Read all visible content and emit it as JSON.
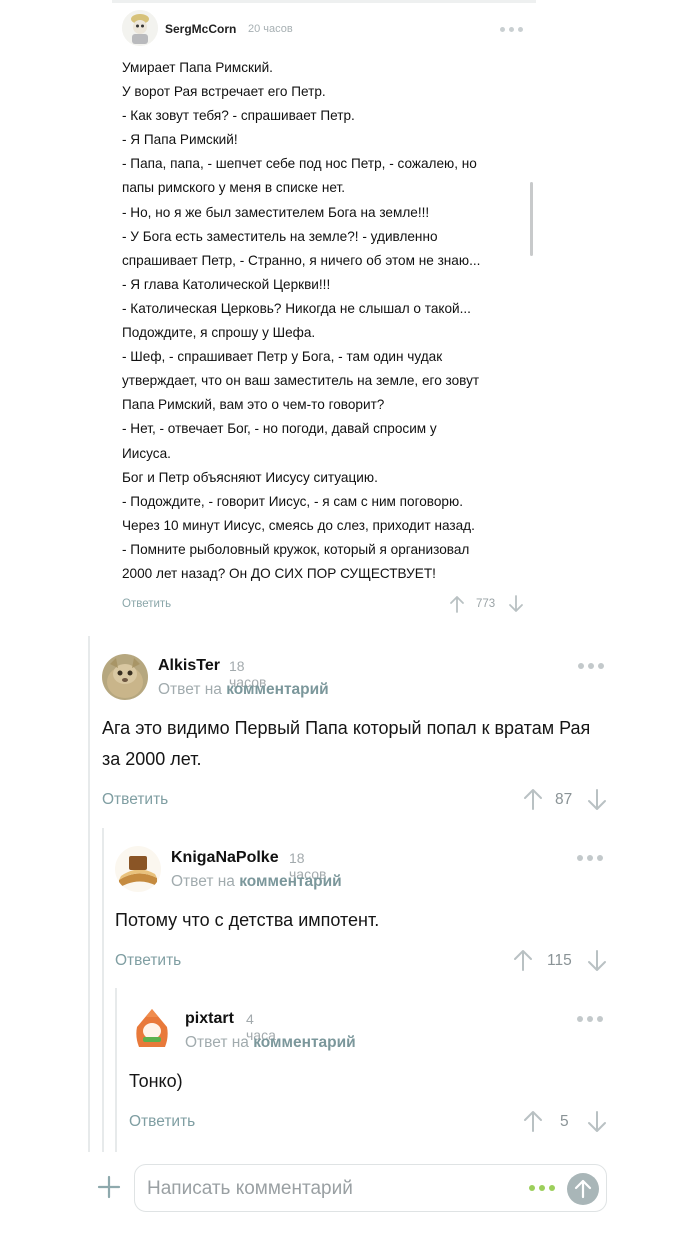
{
  "quoted": {
    "author": "SergMcCorn",
    "time": "20 часов",
    "text": "Умирает Папа Римский.\nУ ворот Рая встречает его Петр.\n- Как зовут тебя? - спрашивает Петр.\n- Я Папа Римский!\n- Папа, папа, - шепчет себе под нос Петр, - сожалею, но\nпапы римского у меня в списке нет.\n- Но, но я же был заместителем Бога на земле!!!\n- У Бога есть заместитель на земле?! - удивленно\nспрашивает Петр, - Странно, я ничего об этом не знаю...\n- Я глава Католической Церкви!!!\n- Католическая Церковь? Никогда не слышал о такой...\nПодождите, я спрошу у Шефа.\n- Шеф, - спрашивает Петр у Бога, - там один чудак\nутверждает, что он ваш заместитель на земле, его зовут\nПапа Римский, вам это о чем-то говорит?\n- Нет, - отвечает Бог, - но погоди, давай спросим у\nИисуса.\nБог и Петр объясняют Иисусу ситуацию.\n- Подождите, - говорит Иисус, - я сам с ним поговорю.\nЧерез 10 минут Иисус, смеясь до слез, приходит назад.\n- Помните рыболовный кружок, который я организовал\n2000 лет назад? Он ДО СИХ ПОР СУЩЕСТВУЕТ!",
    "reply_label": "Ответить",
    "score": "773"
  },
  "comments": [
    {
      "author": "AlkisTer",
      "time": "18 часов",
      "reply_to_prefix": "Ответ на",
      "reply_to_link": "комментарий",
      "text": "Ага это видимо Первый Папа который попал к вратам Рая за 2000 лет.",
      "reply_label": "Ответить",
      "score": "87"
    },
    {
      "author": "KnigaNaPolke",
      "time": "18 часов",
      "reply_to_prefix": "Ответ на",
      "reply_to_link": "комментарий",
      "text": "Потому что с детства импотент.",
      "reply_label": "Ответить",
      "score": "115"
    },
    {
      "author": "pixtart",
      "time": "4 часа",
      "reply_to_prefix": "Ответ на",
      "reply_to_link": "комментарий",
      "text": "Тонко)",
      "reply_label": "Ответить",
      "score": "5"
    }
  ],
  "composer": {
    "placeholder": "Написать комментарий"
  },
  "colors": {
    "accent_link": "#7f9ea2",
    "muted": "#a3aaad",
    "dots_green": "#9ccf5b",
    "send_button": "#a9b6b8",
    "thread_line": "#e7eaeb"
  },
  "icons": [
    "more-dots-icon",
    "arrow-up-icon",
    "arrow-down-icon",
    "plus-icon",
    "send-arrow-icon",
    "more-green-dots-icon"
  ]
}
